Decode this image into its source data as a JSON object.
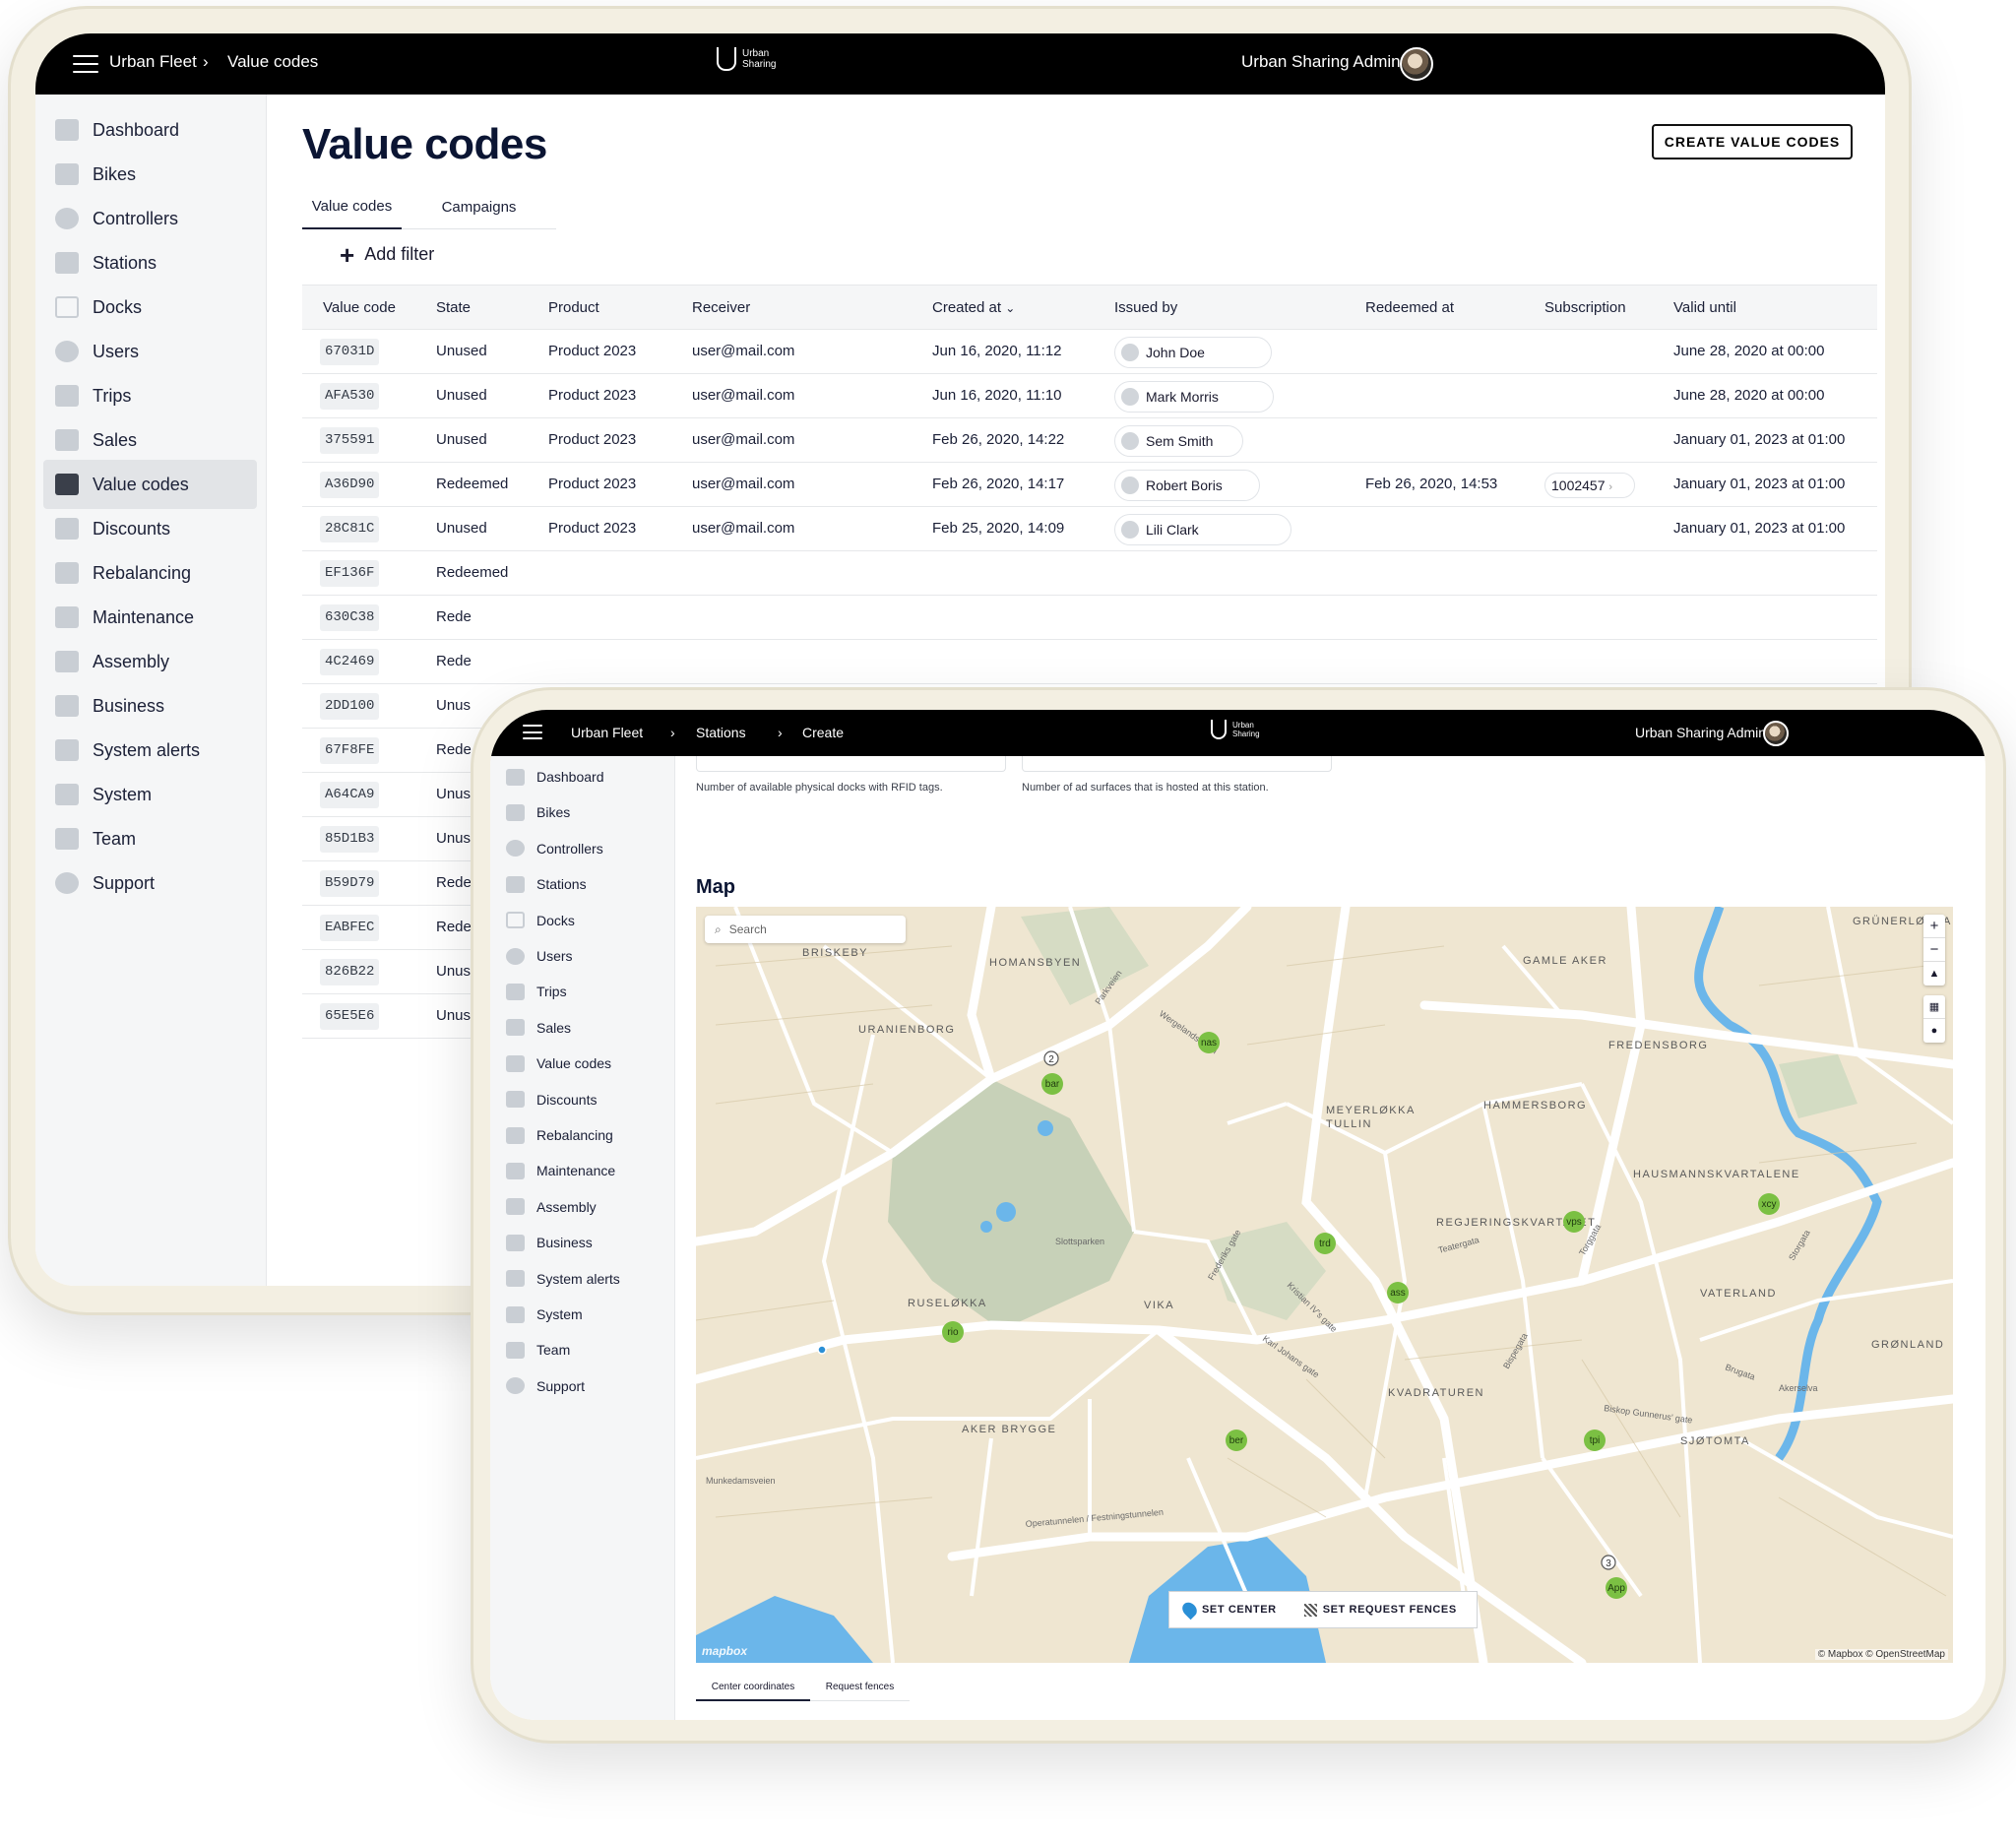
{
  "back_window": {
    "header": {
      "app": "Urban Fleet",
      "page": "Value codes",
      "brand_line1": "Urban",
      "brand_line2": "Sharing",
      "user": "Urban Sharing Admin"
    },
    "sidebar": [
      {
        "label": "Dashboard",
        "icon": "dashboard-icon"
      },
      {
        "label": "Bikes",
        "icon": "bike-icon"
      },
      {
        "label": "Controllers",
        "icon": "controller-icon"
      },
      {
        "label": "Stations",
        "icon": "station-icon"
      },
      {
        "label": "Docks",
        "icon": "dock-icon"
      },
      {
        "label": "Users",
        "icon": "user-icon"
      },
      {
        "label": "Trips",
        "icon": "trips-icon"
      },
      {
        "label": "Sales",
        "icon": "cart-icon"
      },
      {
        "label": "Value codes",
        "icon": "value-codes-icon",
        "active": true
      },
      {
        "label": "Discounts",
        "icon": "discount-icon"
      },
      {
        "label": "Rebalancing",
        "icon": "rebalancing-icon"
      },
      {
        "label": "Maintenance",
        "icon": "wrench-icon"
      },
      {
        "label": "Assembly",
        "icon": "assembly-icon"
      },
      {
        "label": "Business",
        "icon": "business-icon"
      },
      {
        "label": "System alerts",
        "icon": "bell-icon"
      },
      {
        "label": "System",
        "icon": "system-icon"
      },
      {
        "label": "Team",
        "icon": "team-icon"
      },
      {
        "label": "Support",
        "icon": "info-icon"
      }
    ],
    "title": "Value codes",
    "create_button": "CREATE VALUE CODES",
    "tabs": [
      "Value codes",
      "Campaigns"
    ],
    "add_filter": "Add filter",
    "columns": [
      "Value code",
      "State",
      "Product",
      "Receiver",
      "Created at",
      "Issued by",
      "Redeemed at",
      "Subscription",
      "Valid until"
    ],
    "rows": [
      {
        "code": "67031D",
        "state": "Unused",
        "product": "Product 2023",
        "receiver": "user@mail.com",
        "created": "Jun 16, 2020, 11:12",
        "issued_by": "John Doe",
        "redeemed": "",
        "subscription": "",
        "valid": "June 28, 2020 at 00:00"
      },
      {
        "code": "AFA530",
        "state": "Unused",
        "product": "Product 2023",
        "receiver": "user@mail.com",
        "created": "Jun 16, 2020, 11:10",
        "issued_by": "Mark Morris",
        "redeemed": "",
        "subscription": "",
        "valid": "June 28, 2020 at 00:00"
      },
      {
        "code": "375591",
        "state": "Unused",
        "product": "Product 2023",
        "receiver": "user@mail.com",
        "created": "Feb 26, 2020, 14:22",
        "issued_by": "Sem Smith",
        "redeemed": "",
        "subscription": "",
        "valid": "January 01, 2023 at 01:00"
      },
      {
        "code": "A36D90",
        "state": "Redeemed",
        "product": "Product 2023",
        "receiver": "user@mail.com",
        "created": "Feb 26, 2020, 14:17",
        "issued_by": "Robert Boris",
        "redeemed": "Feb 26, 2020, 14:53",
        "subscription": "1002457",
        "valid": "January 01, 2023 at 01:00"
      },
      {
        "code": "28C81C",
        "state": "Unused",
        "product": "Product 2023",
        "receiver": "user@mail.com",
        "created": "Feb 25, 2020, 14:09",
        "issued_by": "Lili Clark",
        "redeemed": "",
        "subscription": "",
        "valid": "January 01, 2023 at 01:00"
      },
      {
        "code": "EF136F",
        "state": "Redeemed"
      },
      {
        "code": "630C38",
        "state": "Rede"
      },
      {
        "code": "4C2469",
        "state": "Rede"
      },
      {
        "code": "2DD100",
        "state": "Unus"
      },
      {
        "code": "67F8FE",
        "state": "Rede"
      },
      {
        "code": "A64CA9",
        "state": "Unus"
      },
      {
        "code": "85D1B3",
        "state": "Unus"
      },
      {
        "code": "B59D79",
        "state": "Rede"
      },
      {
        "code": "EABFEC",
        "state": "Rede"
      },
      {
        "code": "826B22",
        "state": "Unus"
      },
      {
        "code": "65E5E6",
        "state": "Unus"
      }
    ]
  },
  "front_window": {
    "header": {
      "app": "Urban Fleet",
      "crumb2": "Stations",
      "crumb3": "Create",
      "brand_line1": "Urban",
      "brand_line2": "Sharing",
      "user": "Urban Sharing Admin"
    },
    "sidebar": [
      "Dashboard",
      "Bikes",
      "Controllers",
      "Stations",
      "Docks",
      "Users",
      "Trips",
      "Sales",
      "Value codes",
      "Discounts",
      "Rebalancing",
      "Maintenance",
      "Assembly",
      "Business",
      "System alerts",
      "System",
      "Team",
      "Support"
    ],
    "helper_docks": "Number of available physical docks with RFID tags.",
    "helper_ads": "Number of ad surfaces that is hosted at this station.",
    "map_title": "Map",
    "map": {
      "search_placeholder": "Search",
      "areas": [
        "BRISKEBY",
        "HOMANSBYEN",
        "URANIENBORG",
        "GRÜNERLØKKA",
        "GAMLE AKER",
        "FREDENSBORG",
        "MEYERLØKKA",
        "TULLIN",
        "HAMMERSBORG",
        "HAUSMANNSKVARTALENE",
        "REGJERINGSKVARTALET",
        "RUSELØKKA",
        "VIKA",
        "VATERLAND",
        "GRØNLAND",
        "KVADRATUREN",
        "AKER BRYGGE",
        "SJØTOMTA"
      ],
      "streets": [
        "Parkveien",
        "Wergelandsveien",
        "Frederiks gate",
        "Kristian IV's gate",
        "Karl Johans gate",
        "Munkedamsveien",
        "Operatunnelen / Festningstunnelen",
        "Teatergata",
        "Torggata",
        "Storgata",
        "Brugata",
        "Bispegata",
        "Biskop Gunnerus' gate",
        "Slottsparken",
        "Akerselva"
      ],
      "markers": [
        "nas",
        "bar",
        "trd",
        "vps",
        "xcy",
        "ass",
        "rio",
        "ber",
        "tpi",
        "App"
      ],
      "cluster_counts": [
        "2",
        "3"
      ],
      "zoom_in": "+",
      "zoom_out": "−",
      "set_center": "SET CENTER",
      "set_request_fences": "SET REQUEST FENCES",
      "attribution": "© Mapbox © OpenStreetMap",
      "logo": "mapbox"
    },
    "bottom_tabs": [
      "Center coordinates",
      "Request fences"
    ],
    "colors": {
      "marker": "#7bc043",
      "water": "#6bb6ea",
      "park": "#c7d1b8",
      "land": "#efe6d1"
    }
  }
}
